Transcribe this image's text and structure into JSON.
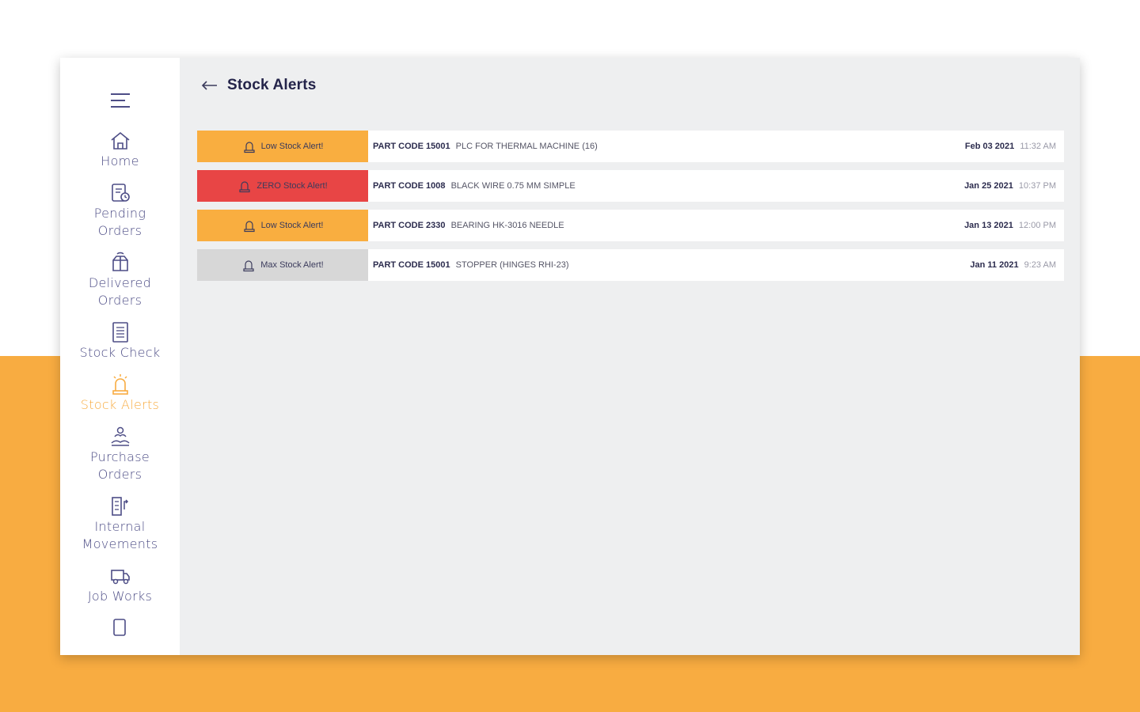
{
  "colors": {
    "accent": "#f8ac41",
    "nav_text": "#4d4d86",
    "low": "#f9ae40",
    "zero": "#e84545",
    "max": "#d7d7d7"
  },
  "header": {
    "title": "Stock Alerts",
    "back_icon": "arrow-left-icon"
  },
  "sidebar": {
    "menu_icon": "hamburger-icon",
    "items": [
      {
        "label": "Home",
        "icon": "home-icon"
      },
      {
        "label": "Pending\nOrders",
        "icon": "pending-orders-icon"
      },
      {
        "label": "Delivered\nOrders",
        "icon": "delivered-orders-icon"
      },
      {
        "label": "Stock Check",
        "icon": "stock-check-icon"
      },
      {
        "label": "Stock Alerts",
        "icon": "alarm-icon",
        "active": true
      },
      {
        "label": "Purchase\nOrders",
        "icon": "purchase-orders-icon"
      },
      {
        "label": "Internal\nMovements",
        "icon": "internal-movements-icon"
      },
      {
        "label": "Job Works",
        "icon": "job-works-icon"
      }
    ]
  },
  "alerts": [
    {
      "type": "low",
      "label": "Low Stock Alert!",
      "code": "PART CODE 15001",
      "description": "PLC FOR THERMAL MACHINE (16)",
      "date": "Feb 03 2021",
      "time": "11:32 AM"
    },
    {
      "type": "zero",
      "label": "ZERO Stock Alert!",
      "code": "PART CODE 1008",
      "description": "BLACK WIRE 0.75 MM SIMPLE",
      "date": "Jan 25 2021",
      "time": "10:37 PM"
    },
    {
      "type": "low",
      "label": "Low Stock Alert!",
      "code": "PART CODE 2330",
      "description": "BEARING HK-3016 NEEDLE",
      "date": "Jan 13 2021",
      "time": "12:00 PM"
    },
    {
      "type": "max",
      "label": "Max Stock Alert!",
      "code": "PART CODE 15001",
      "description": "STOPPER (HINGES RHI-23)",
      "date": "Jan 11 2021",
      "time": "9:23 AM"
    }
  ]
}
